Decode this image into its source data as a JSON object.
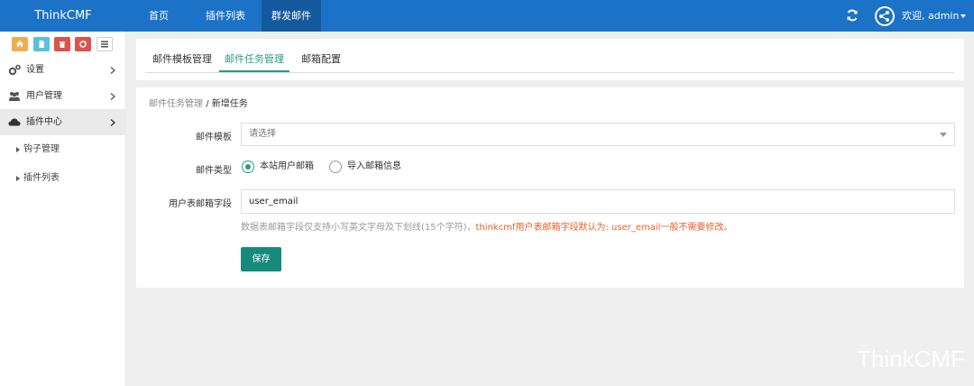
{
  "navbar": {
    "brand": "ThinkCMF",
    "items": [
      {
        "label": "首页"
      },
      {
        "label": "插件列表"
      },
      {
        "label": "群发邮件"
      }
    ],
    "welcome_text": "欢迎, admin"
  },
  "sidebar": {
    "shortcuts": [
      {
        "icon": "home-icon",
        "color": "#f0ad4e"
      },
      {
        "icon": "file-icon",
        "color": "#5bc0de"
      },
      {
        "icon": "trash-icon",
        "color": "#d9534f"
      },
      {
        "icon": "recycle-icon",
        "color": "#d9534f"
      },
      {
        "icon": "list-icon",
        "color": "#ffffff"
      }
    ],
    "menu": [
      {
        "label": "设置",
        "icon": "gears-icon"
      },
      {
        "label": "用户管理",
        "icon": "users-icon"
      },
      {
        "label": "插件中心",
        "icon": "cloud-icon"
      }
    ],
    "submenu": [
      {
        "label": "钩子管理"
      },
      {
        "label": "插件列表"
      }
    ]
  },
  "tabs": [
    {
      "label": "邮件模板管理"
    },
    {
      "label": "邮件任务管理"
    },
    {
      "label": "邮箱配置"
    }
  ],
  "breadcrumb": {
    "parent": "邮件任务管理",
    "current": "/ 新增任务"
  },
  "form": {
    "template_label": "邮件模板",
    "template_placeholder": "请选择",
    "type_label": "邮件类型",
    "type_options": [
      {
        "label": "本站用户邮箱"
      },
      {
        "label": "导入邮箱信息"
      }
    ],
    "field_label": "用户表邮箱字段",
    "field_value": "user_email",
    "help_grey": "数据表邮箱字段仅支持小写英文字母及下划线(15个字符)，",
    "help_orange": "thinkcmf用户表邮箱字段默认为: user_email一般不需要修改。",
    "save_label": "保存"
  },
  "watermark": "ThinkCMF",
  "colors": {
    "navbar": "#1b72c7",
    "accent": "#2a9b7f",
    "save_button": "#178b7b",
    "help_orange": "#e85f2a"
  }
}
